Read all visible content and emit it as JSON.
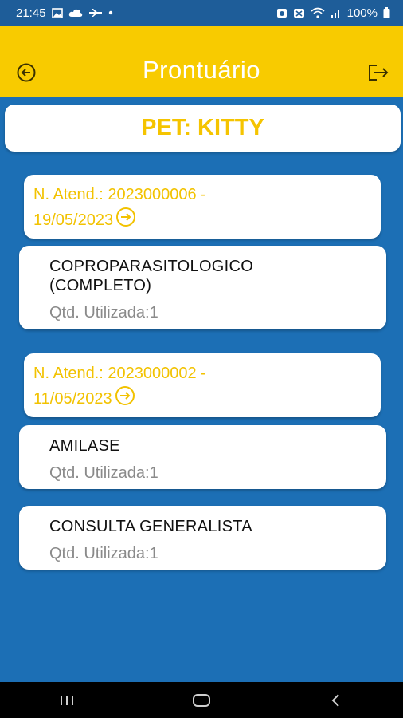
{
  "status_bar": {
    "time": "21:45",
    "battery": "100%",
    "left_icons": [
      "gallery-icon",
      "cloud-icon",
      "plane-icon",
      "dot-icon"
    ],
    "right_icons": [
      "alarm-icon",
      "mute-icon",
      "wifi-icon",
      "signal-icon",
      "battery-icon"
    ]
  },
  "app_bar": {
    "title": "Prontuário",
    "back_icon": "back-circle-icon",
    "logout_icon": "logout-icon",
    "background": "#f8cb00"
  },
  "pet": {
    "label": "PET: KITTY"
  },
  "records": [
    {
      "header": "N. Atend.: 2023000006 -",
      "date": "19/05/2023",
      "items": [
        {
          "name_line1": "COPROPARASITOLOGICO",
          "name_line2": "(COMPLETO)",
          "qtd": "Qtd. Utilizada:1"
        }
      ]
    },
    {
      "header": "N. Atend.: 2023000002 -",
      "date": "11/05/2023",
      "items": [
        {
          "name_line1": "AMILASE",
          "qtd": "Qtd. Utilizada:1"
        },
        {
          "name_line1": "CONSULTA GENERALISTA",
          "qtd": "Qtd. Utilizada:1"
        }
      ]
    }
  ],
  "colors": {
    "primary_blue": "#1c6fb5",
    "accent_yellow": "#f5c400",
    "status_bar": "#1e5d99"
  },
  "nav_icons": [
    "recent-apps-icon",
    "home-icon",
    "back-icon"
  ]
}
